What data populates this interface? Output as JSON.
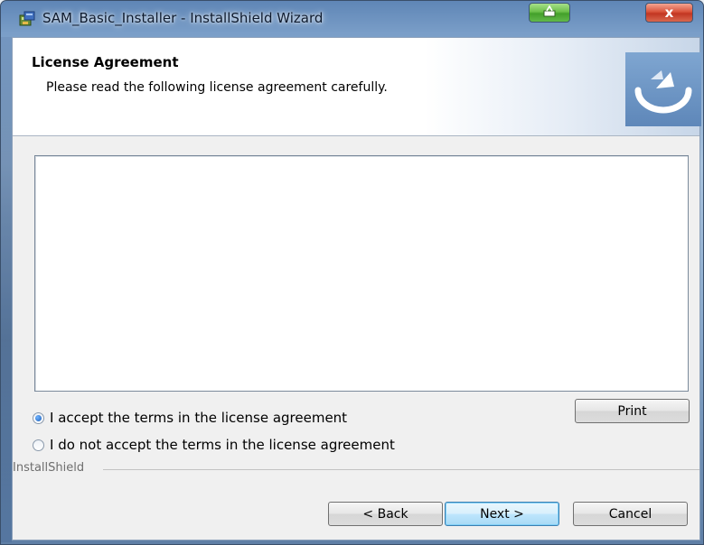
{
  "window": {
    "title": "SAM_Basic_Installer - InstallShield Wizard",
    "close_glyph": "x"
  },
  "banner": {
    "title": "License Agreement",
    "subtitle": "Please read the following license agreement carefully."
  },
  "license": {
    "options": [
      {
        "label": "I accept the terms in the license agreement",
        "selected": true
      },
      {
        "label": "I do not accept the terms in the license agreement",
        "selected": false
      }
    ],
    "print_label": "Print"
  },
  "footer": {
    "group_label": "InstallShield",
    "back_label": "< Back",
    "next_label": "Next >",
    "cancel_label": "Cancel"
  },
  "colors": {
    "accent": "#3c7fb1",
    "close_button": "#c23622",
    "restore_button": "#43a02a"
  }
}
